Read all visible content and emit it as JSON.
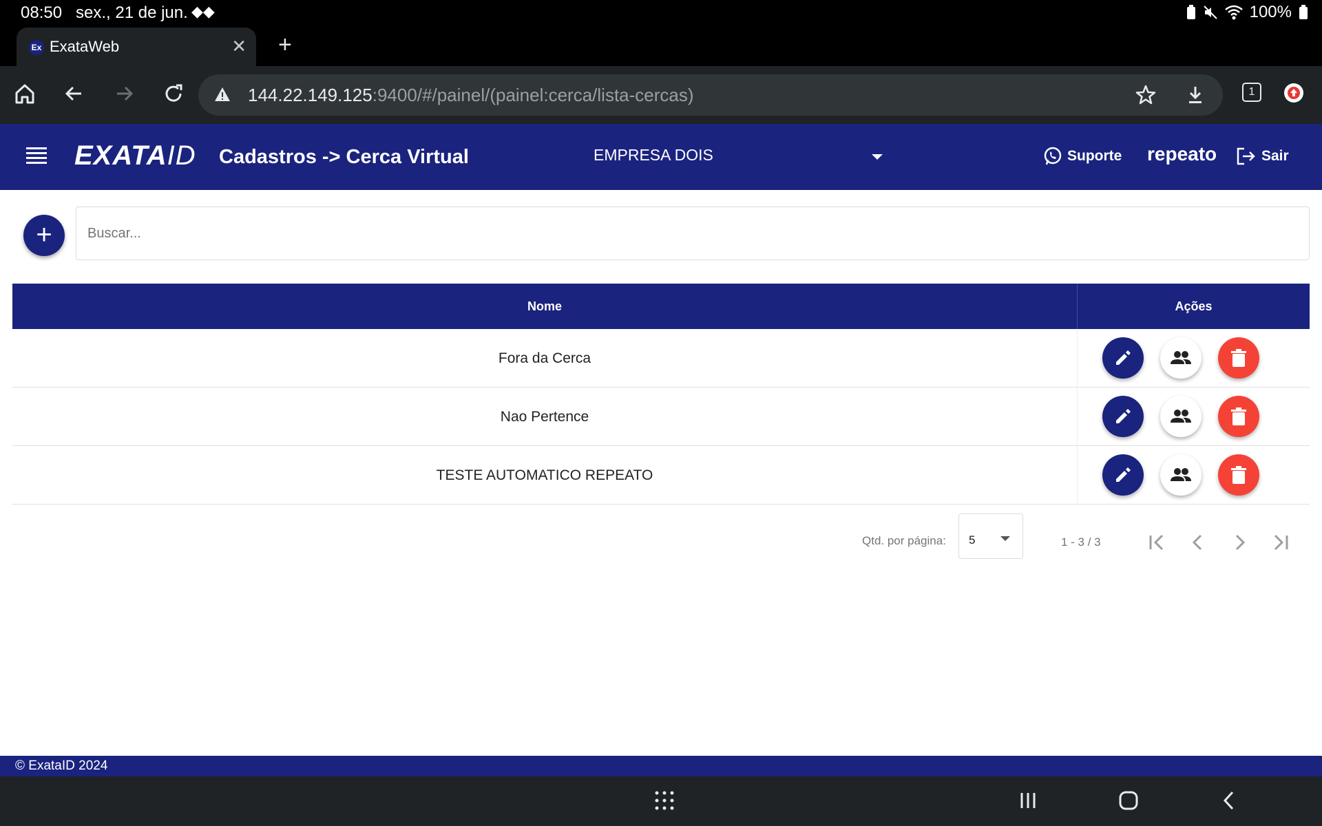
{
  "status_bar": {
    "time": "08:50",
    "date": "sex., 21 de jun.",
    "battery": "100%"
  },
  "browser": {
    "tab_title": "ExataWeb",
    "tab_favicon": "Ex",
    "url_host": "144.22.149.125",
    "url_rest": ":9400/#/painel/(painel:cerca/lista-cercas)",
    "tab_count": "1"
  },
  "header": {
    "logo_main": "EXATA",
    "logo_id": "ID",
    "title": "Cadastros -> Cerca Virtual",
    "company": "EMPRESA DOIS",
    "support_label": "Suporte",
    "username": "repeato",
    "logout_label": "Sair"
  },
  "search": {
    "placeholder": "Buscar..."
  },
  "table": {
    "headers": {
      "nome": "Nome",
      "acoes": "Ações"
    },
    "rows": [
      {
        "nome": "Fora da Cerca"
      },
      {
        "nome": "Nao Pertence"
      },
      {
        "nome": "TESTE AUTOMATICO REPEATO"
      }
    ]
  },
  "paginator": {
    "label": "Qtd. por página:",
    "page_size": "5",
    "range": "1 - 3 / 3"
  },
  "footer": {
    "copyright": "© ExataID 2024"
  },
  "colors": {
    "primary": "#1a237e",
    "danger": "#f44336",
    "chrome_dark": "#1f2326"
  }
}
